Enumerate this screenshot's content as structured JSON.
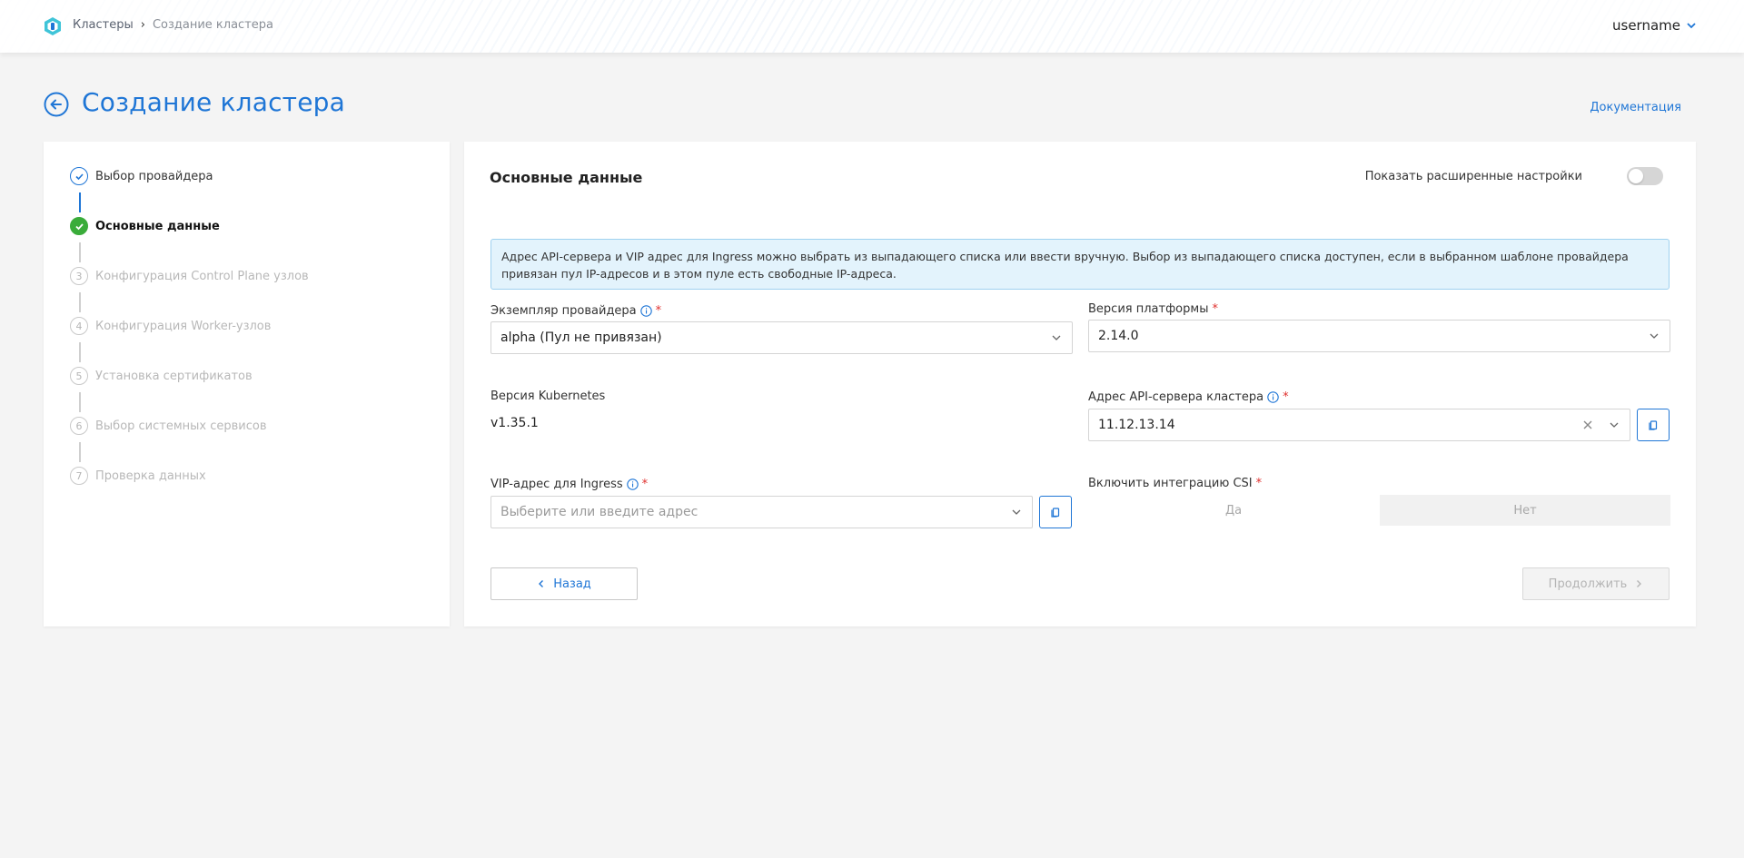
{
  "header": {
    "breadcrumb": {
      "clusters": "Кластеры",
      "current": "Создание кластера"
    },
    "user": "username",
    "icons": {
      "logo": "app-logo-icon",
      "user_dropdown": "chevron-down-icon"
    }
  },
  "page": {
    "title": "Создание кластера",
    "doc_link": "Документация"
  },
  "steps": [
    {
      "number": "1",
      "label": "Выбор провайдера",
      "state": "done"
    },
    {
      "number": "2",
      "label": "Основные данные",
      "state": "active"
    },
    {
      "number": "3",
      "label": "Конфигурация Control Plane узлов",
      "state": "pending"
    },
    {
      "number": "4",
      "label": "Конфигурация Worker-узлов",
      "state": "pending"
    },
    {
      "number": "5",
      "label": "Установка сертификатов",
      "state": "pending"
    },
    {
      "number": "6",
      "label": "Выбор системных сервисов",
      "state": "pending"
    },
    {
      "number": "7",
      "label": "Проверка данных",
      "state": "pending"
    }
  ],
  "form": {
    "section_title": "Основные данные",
    "advanced_label": "Показать расширенные настройки",
    "advanced_enabled": false,
    "info_text_line1": "Адрес API-сервера и VIP адрес для Ingress можно выбрать из выпадающего списка или ввести вручную. Выбор из выпадающего списка доступен, если в выбранном шаблоне провайдера",
    "info_text_line2": "привязан пул IP-адресов и в этом пуле есть свободные IP-адреса.",
    "provider_instance": {
      "label": "Экземпляр провайдера",
      "required": "*",
      "value": "alpha (Пул не привязан)"
    },
    "platform_version": {
      "label": "Версия платформы",
      "required": "*",
      "value": "2.14.0"
    },
    "kubernetes_version": {
      "label": "Версия Kubernetes",
      "value": "v1.35.1"
    },
    "api_server": {
      "label": "Адрес API-сервера кластера",
      "required": "*",
      "value": "11.12.13.14"
    },
    "vip_ingress": {
      "label": "VIP-адрес для Ingress",
      "required": "*",
      "placeholder": "Выберите или введите адрес"
    },
    "csi": {
      "label": "Включить интеграцию CSI",
      "required": "*",
      "yes": "Да",
      "no": "Нет",
      "selected": "no"
    },
    "back_button": "Назад",
    "next_button": "Продолжить"
  },
  "colors": {
    "accent": "#1f76d6",
    "success": "#3aac3a",
    "required": "#e0302e",
    "info_bg": "#e3f3fc"
  }
}
